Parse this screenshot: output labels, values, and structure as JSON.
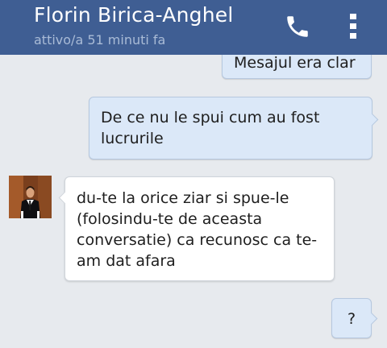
{
  "header": {
    "contact_name": "Florin Birica-Anghel",
    "status": "attivo/a 51 minuti fa",
    "call_icon": "phone-icon",
    "menu_icon": "more-vert-icon",
    "bg_color": "#3f5e93"
  },
  "messages": [
    {
      "direction": "sent",
      "text": "Mesajul era clar"
    },
    {
      "direction": "sent",
      "text": "De ce nu le spui cum au fost lucrurile"
    },
    {
      "direction": "received",
      "text": "du-te la orice ziar si spue-le (folosindu-te de aceasta conversatie) ca recunosc ca te-am dat afara"
    },
    {
      "direction": "sent",
      "text": "?"
    }
  ],
  "colors": {
    "sent_bubble": "#dbe8f8",
    "received_bubble": "#ffffff",
    "background": "#e7eaee"
  }
}
